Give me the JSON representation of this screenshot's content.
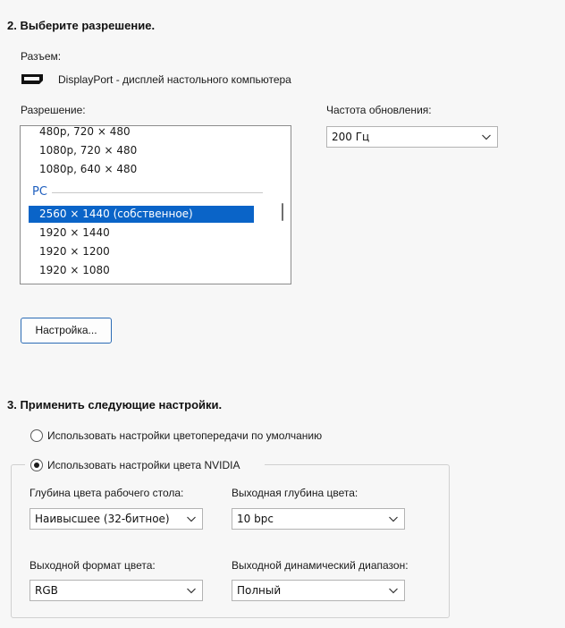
{
  "section2": {
    "title": "2. Выберите разрешение.",
    "connector_label": "Разъем:",
    "connector_icon": "displayport-icon",
    "connector_value": "DisplayPort - дисплей настольного компьютера",
    "resolution_label": "Разрешение:",
    "refresh_label": "Частота обновления:",
    "refresh_value": "200 Гц",
    "resolutions_top": [
      "480p, 720 × 480",
      "1080p, 720 × 480",
      "1080p, 640 × 480"
    ],
    "pc_group": "PC",
    "resolutions_pc": [
      "2560 × 1440 (собственное)",
      "1920 × 1440",
      "1920 × 1200",
      "1920 × 1080"
    ],
    "selected_resolution": "2560 × 1440 (собственное)",
    "customize_button": "Настройка..."
  },
  "section3": {
    "title": "3. Применить следующие настройки.",
    "radio_default": "Использовать настройки цветопередачи по умолчанию",
    "radio_nvidia": "Использовать настройки цвета NVIDIA",
    "selected_radio": "nvidia",
    "desktop_depth_label": "Глубина цвета рабочего стола:",
    "desktop_depth_value": "Наивысшее (32-битное)",
    "output_depth_label": "Выходная глубина цвета:",
    "output_depth_value": "10 bpc",
    "output_format_label": "Выходной формат цвета:",
    "output_format_value": "RGB",
    "output_range_label": "Выходной динамический диапазон:",
    "output_range_value": "Полный"
  },
  "colors": {
    "accent": "#0a64c8",
    "pc_group": "#1f5fbf",
    "button_border": "#2b6bb5",
    "background": "#f7f7f7"
  }
}
